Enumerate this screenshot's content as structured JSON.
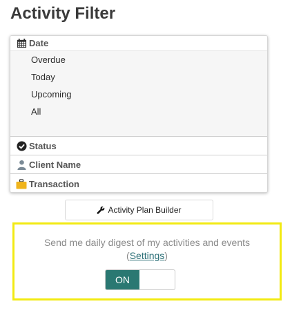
{
  "page": {
    "title": "Activity Filter"
  },
  "filters": {
    "date": {
      "label": "Date",
      "options": [
        "Overdue",
        "Today",
        "Upcoming",
        "All"
      ]
    },
    "status": {
      "label": "Status"
    },
    "client_name": {
      "label": "Client Name"
    },
    "transaction": {
      "label": "Transaction"
    }
  },
  "builder_button": {
    "label": "Activity Plan Builder",
    "icon": "wrench-icon"
  },
  "digest": {
    "text": "Send me daily digest of my activities and events",
    "open_paren": "(",
    "settings_link": "Settings",
    "close_paren": ")",
    "toggle_label": "ON",
    "toggle_color": "#2a7872",
    "highlight_color": "#f2ea12"
  }
}
